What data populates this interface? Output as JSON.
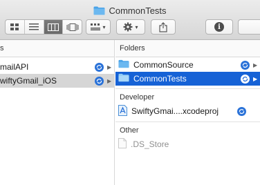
{
  "window": {
    "title": "CommonTests"
  },
  "toolbar": {
    "view_modes": [
      "icon-view",
      "list-view",
      "column-view",
      "coverflow-view"
    ],
    "active_view": "column-view",
    "info_symbol": "i"
  },
  "left_column": {
    "header": "s",
    "items": [
      {
        "label": "mailAPI",
        "icon": "sync-icon",
        "has_children": true,
        "selected": false
      },
      {
        "label": "wiftyGmail_iOS",
        "icon": "sync-icon",
        "has_children": true,
        "selected": true
      }
    ]
  },
  "right_column": {
    "sections": [
      {
        "header": "Folders",
        "items": [
          {
            "label": "CommonSource",
            "icon": "folder-icon",
            "has_children": true,
            "selected": false
          },
          {
            "label": "CommonTests",
            "icon": "folder-icon",
            "has_children": true,
            "selected": true
          }
        ]
      },
      {
        "header": "Developer",
        "items": [
          {
            "label": "SwiftyGmai....xcodeproj",
            "icon": "xcodeproj-icon",
            "has_children": false,
            "selected": false
          }
        ]
      },
      {
        "header": "Other",
        "items": [
          {
            "label": ".DS_Store",
            "icon": "file-icon",
            "has_children": false,
            "selected": false,
            "dimmed": true
          }
        ]
      }
    ]
  },
  "colors": {
    "selection_blue": "#1662d6",
    "folder_blue": "#4aa3e8",
    "sync_badge": "#2a72d8"
  }
}
